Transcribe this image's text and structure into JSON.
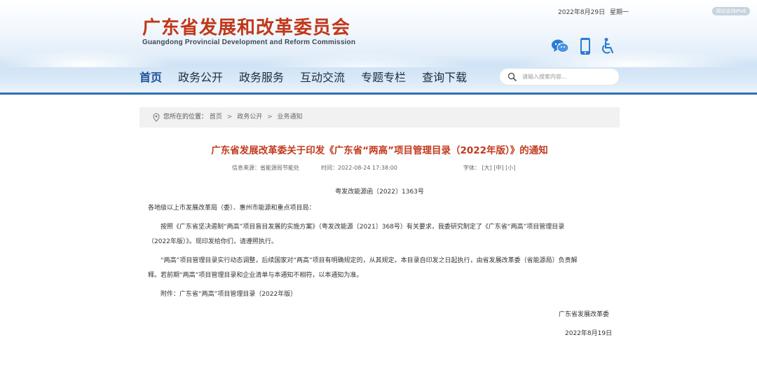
{
  "header": {
    "title_cn": "广东省发展和改革委员会",
    "title_en": "Guangdong Provincial Development and Reform Commission",
    "date": "2022年8月29日",
    "weekday": "星期一",
    "ipv6_badge": "网站支持IPv6",
    "icons": [
      "wechat-icon",
      "mobile-icon",
      "accessibility-icon"
    ],
    "accent_color": "#c1371a",
    "nav_color": "#1d4f9a"
  },
  "nav": {
    "items": [
      "首页",
      "政务公开",
      "政务服务",
      "互动交流",
      "专题专栏",
      "查询下载"
    ],
    "active": "首页"
  },
  "search": {
    "placeholder": "请输入搜索内容..."
  },
  "breadcrumb": {
    "prefix": "您所在的位置：",
    "items": [
      "首页",
      "政务公开",
      "业务通知"
    ],
    "separator": ">"
  },
  "article": {
    "title": "广东省发展改革委关于印发《广东省“两高”项目管理目录（2022年版）》的通知",
    "source": "信息来源：省能源局节能处",
    "time": "时间：2022-08-24 17:38:00",
    "font_label": "字体：",
    "font_sizes": [
      "[大]",
      "[中]",
      "[小]"
    ],
    "doc_number": "粤发改能源函〔2022〕1363号",
    "salutation": "各地级以上市发展改革局（委）、惠州市能源和重点项目局：",
    "para1_line1": "按照《广东省坚决遏制“两高”项目盲目发展的实施方案》（粤发改能源〔2021〕368号）有关要求，我委研究制定了《广东省“两高”项目管理目录",
    "para1_line2": "（2022年版）》。现印发给你们，请遵照执行。",
    "para2_line1": "“两高”项目管理目录实行动态调整，后续国家对“两高”项目有明确规定的，从其规定。本目录自印发之日起执行，由省发展改革委（省能源局）负责解",
    "para2_line2": "释。若前期“两高”项目管理目录和企业清单与本通知不相符，以本通知为准。",
    "attachment": "附件：广东省“两高”项目管理目录（2022年版）",
    "signature": "广东省发展改革委",
    "sign_date": "2022年8月19日"
  }
}
